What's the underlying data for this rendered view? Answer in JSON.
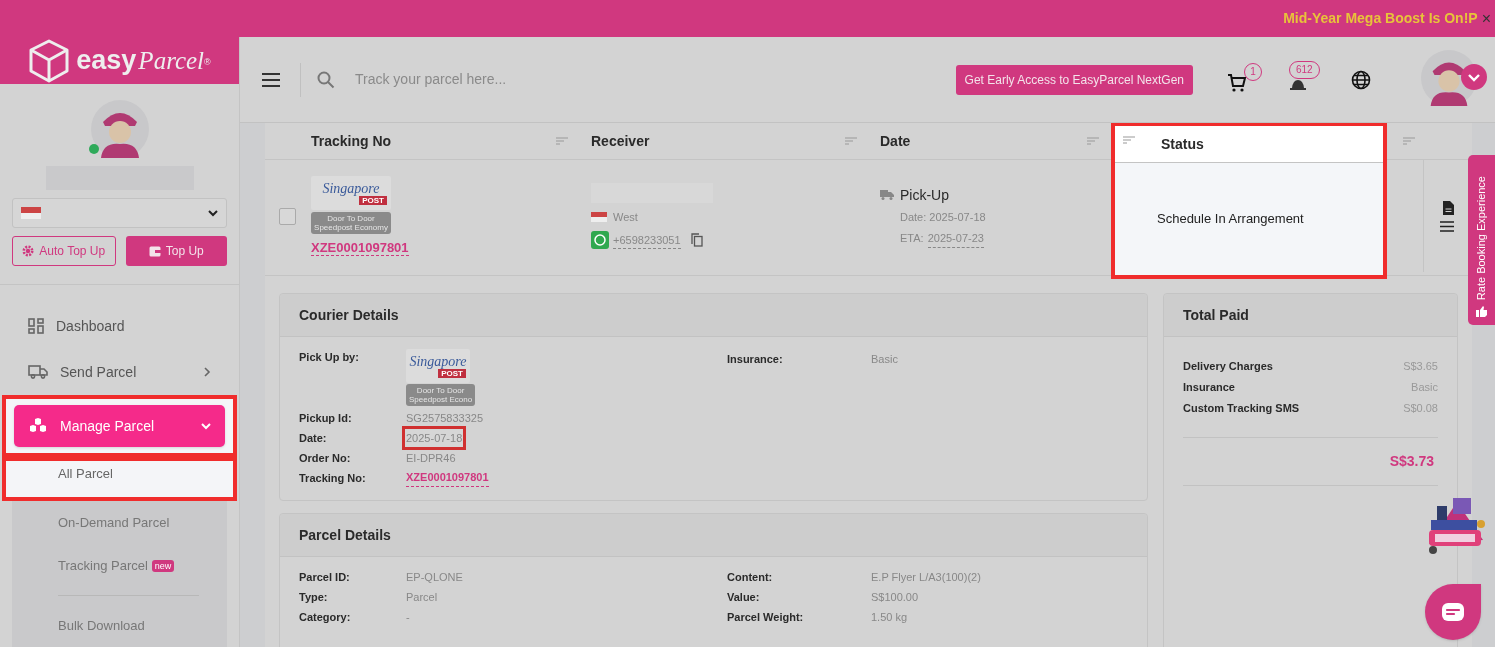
{
  "banner": {
    "text": "Mid-Year Mega Boost Is On!P",
    "close": "×"
  },
  "logo": {
    "word1": "easy",
    "word2": "Parcel",
    "mark": "®"
  },
  "header": {
    "search_placeholder": "Track your parcel here...",
    "cta": "Get Early Access to EasyParcel NextGen",
    "cart_count": "1",
    "notification_count": "612"
  },
  "sidebar": {
    "buttons": [
      {
        "label": "Auto Top Up",
        "kind": "outline"
      },
      {
        "label": "Top Up",
        "kind": "solid"
      }
    ],
    "nav": [
      {
        "label": "Dashboard",
        "selected": false
      },
      {
        "label": "Send Parcel",
        "selected": false,
        "expanded": false
      },
      {
        "label": "Manage Parcel",
        "selected": true,
        "highlighted": true,
        "expanded": true,
        "children": [
          {
            "label": "All Parcel",
            "selected": true,
            "highlighted": true
          },
          {
            "label": "On-Demand Parcel",
            "selected": false
          },
          {
            "label": "Tracking Parcel",
            "selected": false,
            "badge": "new"
          },
          {
            "label": "Bulk Download",
            "selected": false,
            "divider_before": true
          }
        ]
      }
    ]
  },
  "table": {
    "columns": [
      {
        "label": "Tracking No",
        "highlighted": false
      },
      {
        "label": "Receiver",
        "highlighted": false
      },
      {
        "label": "Date",
        "highlighted": false
      },
      {
        "label": "Status",
        "highlighted": true
      }
    ],
    "rows": [
      {
        "checked": false,
        "courier_logo": {
          "script": "Singapore",
          "tag": "POST"
        },
        "service": [
          "Door To Door",
          "Speedpost Economy"
        ],
        "tracking_no": "XZE0001097801",
        "region": "West",
        "phone": "+6598233051",
        "date_type": "Pick-Up",
        "date": "Date: 2025-07-18",
        "eta_label": "ETA:",
        "eta": "2025-07-23",
        "status": "Schedule In Arrangement"
      }
    ]
  },
  "courier_details": {
    "title": "Courier Details",
    "pick_up_label": "Pick Up by:",
    "courier_logo": {
      "script": "Singapore",
      "tag": "POST"
    },
    "service": [
      "Door To Door",
      "Speedpost Econo"
    ],
    "left": [
      {
        "label": "Pickup Id:",
        "value": "SG2575833325",
        "kind": "text"
      },
      {
        "label": "Date:",
        "value": "2025-07-18",
        "kind": "text",
        "highlighted": true
      },
      {
        "label": "Order No:",
        "value": "EI-DPR46",
        "kind": "text"
      },
      {
        "label": "Tracking No:",
        "value": "XZE0001097801",
        "kind": "link"
      }
    ],
    "right": [
      {
        "label": "Insurance:",
        "value": "Basic"
      }
    ]
  },
  "total_paid": {
    "title": "Total Paid",
    "items": [
      {
        "label": "Delivery Charges",
        "value": "S$3.65"
      },
      {
        "label": "Insurance",
        "value": "Basic"
      },
      {
        "label": "Custom Tracking SMS",
        "value": "S$0.08"
      }
    ],
    "total": "S$3.73"
  },
  "parcel_details": {
    "title": "Parcel Details",
    "left": [
      {
        "label": "Parcel ID:",
        "value": "EP-QLONE"
      },
      {
        "label": "Type:",
        "value": "Parcel"
      },
      {
        "label": "Category:",
        "value": "-"
      }
    ],
    "right": [
      {
        "label": "Content:",
        "value": "E.P Flyer L/A3(100)(2)"
      },
      {
        "label": "Value:",
        "value": "S$100.00"
      },
      {
        "label": "Parcel Weight:",
        "value": "1.50 kg"
      }
    ]
  },
  "rate_tab": "Rate Booking Experience"
}
